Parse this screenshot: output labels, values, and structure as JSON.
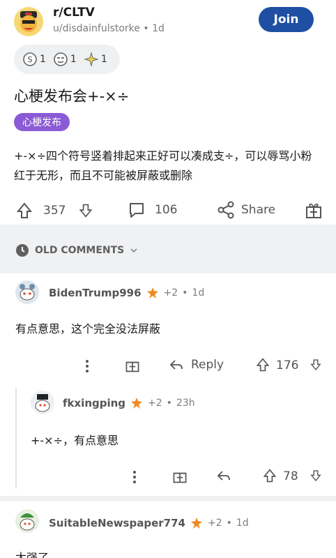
{
  "post": {
    "subreddit": "r/CLTV",
    "author": "u/disdainfulstorke",
    "age": "1d",
    "join_label": "Join",
    "awards": [
      {
        "icon": "silver-award-icon",
        "count": "1"
      },
      {
        "icon": "face-award-icon",
        "count": "1"
      },
      {
        "icon": "sparkle-award-icon",
        "count": "1"
      }
    ],
    "title": "心梗发布会+-×÷",
    "flair": "心梗发布",
    "body": "+-×÷四个符号竖着排起来正好可以凑成支÷，可以辱骂小粉红于无形，而且不可能被屏蔽或删除",
    "votes": "357",
    "comments": "106",
    "share_label": "Share"
  },
  "sort": {
    "label": "OLD COMMENTS"
  },
  "comments": [
    {
      "user": "BidenTrump996",
      "score": "+2",
      "age": "1d",
      "text": "有点意思，这个完全没法屏蔽",
      "reply_label": "Reply",
      "votes": "176"
    },
    {
      "user": "fkxingping",
      "score": "+2",
      "age": "23h",
      "text": "+-×÷，有点意思",
      "votes": "78"
    },
    {
      "user": "SuitableNewspaper774",
      "score": "+2",
      "age": "1d",
      "text": "太强了"
    }
  ],
  "colors": {
    "accent": "#1f4fa3",
    "flair": "#8b5bd6",
    "band": "#f0f1f3"
  }
}
